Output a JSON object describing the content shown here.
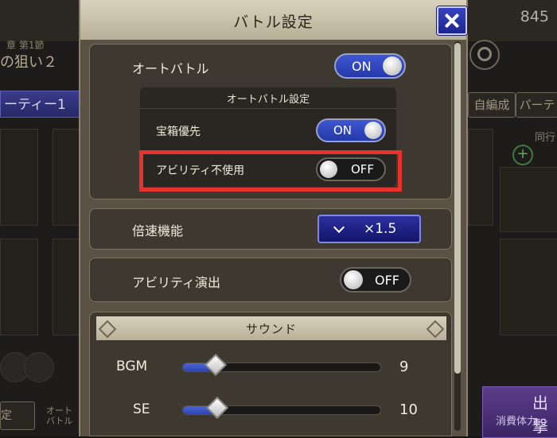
{
  "background": {
    "chapter_label": "章 第1節",
    "stage_title": "の狙い２",
    "currency_value": "845",
    "party_tab": "ーティー1",
    "auto_edit_button": "自編成",
    "party_button": "パーテ",
    "side_label": "同行",
    "settings_button": "定",
    "bottom_label": "オート\nバトル",
    "sortie_label": "出撃",
    "stamina_label": "消費体力"
  },
  "modal": {
    "title": "バトル設定",
    "auto_battle": {
      "label": "オートバトル",
      "state": "ON"
    },
    "auto_settings": {
      "title": "オートバトル設定",
      "treasure_priority": {
        "label": "宝箱優先",
        "state": "ON"
      },
      "ability_disabled": {
        "label": "アビリティ不使用",
        "state": "OFF"
      }
    },
    "speed": {
      "label": "倍速機能",
      "value": "×1.5"
    },
    "ability_effect": {
      "label": "アビリティ演出",
      "state": "OFF"
    },
    "sound": {
      "title": "サウンド",
      "bgm": {
        "label": "BGM",
        "value": "9",
        "level": 0.09
      },
      "se": {
        "label": "SE",
        "value": "10",
        "level": 0.1
      }
    }
  },
  "colors": {
    "toggle_on": "#2f46bb",
    "highlight": "#e8322e",
    "panel": "#3d3830"
  }
}
